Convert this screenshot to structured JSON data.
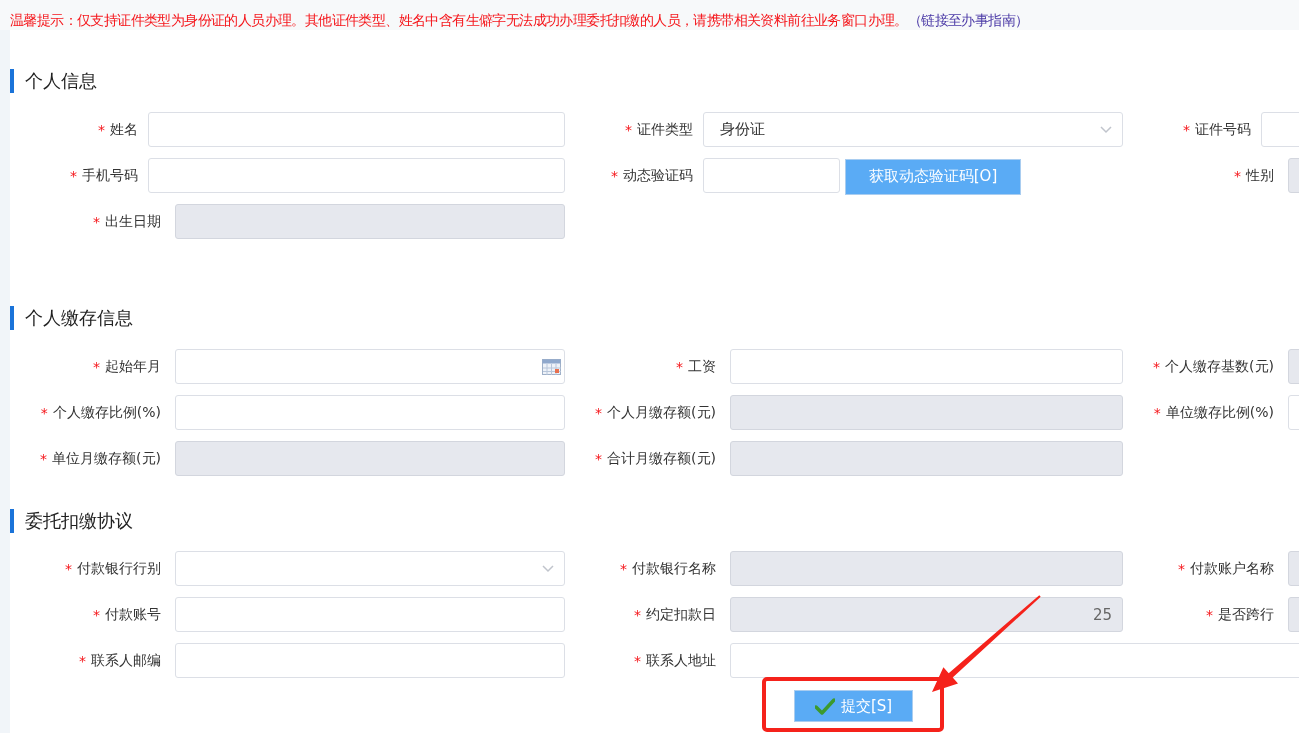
{
  "notice": {
    "text": "温馨提示：仅支持证件类型为身份证的人员办理。其他证件类型、姓名中含有生僻字无法成功办理委托扣缴的人员，请携带相关资料前往业务窗口办理。",
    "link": "（链接至办事指南）"
  },
  "sections": [
    {
      "title": "个人信息",
      "fields": [
        {
          "label": "姓名",
          "mark": "*",
          "kind": "text",
          "disabled": false
        },
        {
          "label": "证件类型",
          "mark": "*",
          "kind": "select",
          "disabled": false,
          "value": "身份证"
        },
        {
          "label": "证件号码",
          "mark": "*",
          "kind": "text",
          "disabled": false
        },
        {
          "label": "手机号码",
          "mark": "*",
          "kind": "text",
          "disabled": false
        },
        {
          "label": "动态验证码",
          "mark": "*",
          "kind": "captcha",
          "disabled": false,
          "button": "获取动态验证码[O]"
        },
        {
          "label": "性别",
          "mark": "*",
          "kind": "text",
          "disabled": true
        },
        {
          "label": "出生日期",
          "mark": "*",
          "kind": "text",
          "disabled": true
        }
      ]
    },
    {
      "title": "个人缴存信息",
      "fields": [
        {
          "label": "起始年月",
          "mark": "*",
          "kind": "date",
          "disabled": false
        },
        {
          "label": "工资",
          "mark": "*",
          "kind": "text",
          "disabled": false
        },
        {
          "label": "个人缴存基数(元)",
          "mark": "*",
          "kind": "text",
          "disabled": true
        },
        {
          "label": "个人缴存比例(%)",
          "mark": "*",
          "kind": "text",
          "disabled": false
        },
        {
          "label": "个人月缴存额(元)",
          "mark": "*",
          "kind": "text",
          "disabled": true
        },
        {
          "label": "单位缴存比例(%)",
          "mark": "*",
          "kind": "text",
          "disabled": false
        },
        {
          "label": "单位月缴存额(元)",
          "mark": "*",
          "kind": "text",
          "disabled": true
        },
        {
          "label": "合计月缴存额(元)",
          "mark": "*",
          "kind": "text",
          "disabled": true
        }
      ]
    },
    {
      "title": "委托扣缴协议",
      "fields": [
        {
          "label": "付款银行行别",
          "mark": "*",
          "kind": "select",
          "disabled": false
        },
        {
          "label": "付款银行名称",
          "mark": "*",
          "kind": "text",
          "disabled": true
        },
        {
          "label": "付款账户名称",
          "mark": "*",
          "kind": "text",
          "disabled": true
        },
        {
          "label": "付款账号",
          "mark": "*",
          "kind": "text",
          "disabled": false
        },
        {
          "label": "约定扣款日",
          "mark": "*",
          "kind": "text",
          "disabled": true,
          "value": "25"
        },
        {
          "label": "是否跨行",
          "mark": "*",
          "kind": "text",
          "disabled": true
        },
        {
          "label": "联系人邮编",
          "mark": "*",
          "kind": "text",
          "disabled": false
        },
        {
          "label": "联系人地址",
          "mark": "*",
          "kind": "long-text",
          "disabled": false
        }
      ]
    }
  ],
  "submit": {
    "label": "提交[S]"
  }
}
